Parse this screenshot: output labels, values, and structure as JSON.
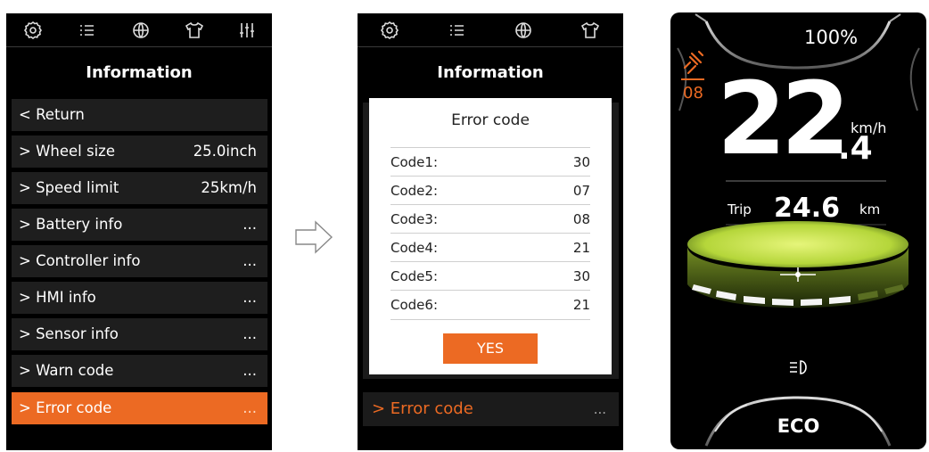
{
  "screen1": {
    "title": "Information",
    "icons": [
      "gear-icon",
      "list-icon",
      "globe-icon",
      "shirt-icon",
      "sliders-icon"
    ],
    "items": [
      {
        "label": "< Return",
        "value": ""
      },
      {
        "label": "> Wheel size",
        "value": "25.0inch"
      },
      {
        "label": "> Speed limit",
        "value": "25km/h"
      },
      {
        "label": "> Battery info",
        "value": "..."
      },
      {
        "label": "> Controller info",
        "value": "..."
      },
      {
        "label": "> HMI info",
        "value": "..."
      },
      {
        "label": "> Sensor info",
        "value": "..."
      },
      {
        "label": "> Warn code",
        "value": "..."
      },
      {
        "label": "> Error code",
        "value": "..."
      }
    ]
  },
  "screen2": {
    "title": "Information",
    "icons": [
      "gear-icon",
      "list-icon",
      "globe-icon",
      "shirt-icon"
    ],
    "modal": {
      "title": "Error code",
      "rows": [
        {
          "key": "Code1:",
          "value": "30"
        },
        {
          "key": "Code2:",
          "value": "07"
        },
        {
          "key": "Code3:",
          "value": "08"
        },
        {
          "key": "Code4:",
          "value": "21"
        },
        {
          "key": "Code5:",
          "value": "30"
        },
        {
          "key": "Code6:",
          "value": "21"
        }
      ],
      "button": "YES"
    },
    "background_item": {
      "label": "> Error code",
      "value": "..."
    }
  },
  "dashboard": {
    "battery": "100%",
    "motor_code": "08",
    "speed_int": "22",
    "speed_dec": ".4",
    "speed_unit": "km/h",
    "trip_label": "Trip",
    "trip_value": "24.6",
    "trip_unit": "km",
    "mode": "ECO",
    "accent": "#ec6a23",
    "glow": "#c8e84a"
  }
}
